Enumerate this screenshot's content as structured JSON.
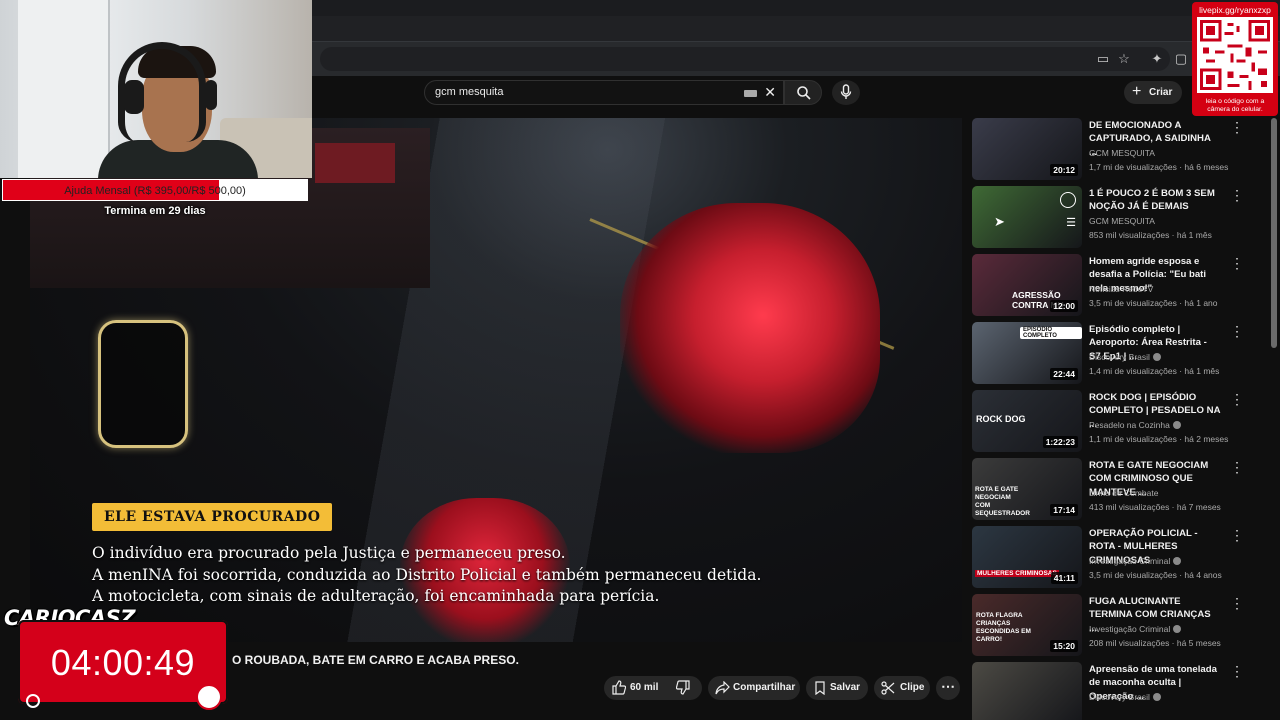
{
  "search": {
    "query": "gcm mesquita"
  },
  "header": {
    "create_label": "Criar"
  },
  "video": {
    "caption_tag": "ELE ESTAVA PROCURADO",
    "caption_lines": [
      "O indivíduo era procurado pela Justiça e permaneceu preso.",
      "A menINA foi socorrida, conduzida ao Distrito Policial e também permaneceu detida.",
      "A motocicleta, com sinais de adulteração, foi encaminhada para perícia."
    ],
    "title_visible": "O ROUBADA, BATE EM CARRO E ACABA PRESO.",
    "likes": "60 mil",
    "share_label": "Compartilhar",
    "save_label": "Salvar",
    "clip_label": "Clipe"
  },
  "recommendations": [
    {
      "title": "DE EMOCIONADO A CAPTURADO, A SAIDINHA ...",
      "channel": "GCM MESQUITA",
      "meta": "1,7 mi de visualizações · há 6 meses",
      "duration": "20:12",
      "verified": false,
      "thumb": "#3a3c4a"
    },
    {
      "title": "1 É POUCO 2 É BOM 3 SEM NOÇÃO JÁ É DEMAIS",
      "channel": "GCM MESQUITA",
      "meta": "853 mil visualizações · há 1 mês",
      "duration": "",
      "verified": false,
      "thumb": "#3f6a35"
    },
    {
      "title": "Homem agride esposa e desafia a Polícia: \"Eu bati nela mesmo!\"",
      "channel": "Notícias RedeTV",
      "meta": "3,5 mi de visualizações · há 1 ano",
      "duration": "12:00",
      "verified": false,
      "thumb": "#5a2a3a",
      "thumb_text": "AGRESSÃO CONTRA MU"
    },
    {
      "title": "Episódio completo | Aeroporto: Área Restrita - S7 Ep1 | ...",
      "channel": "Discovery Brasil",
      "meta": "1,4 mi de visualizações · há 1 mês",
      "duration": "22:44",
      "verified": true,
      "thumb": "#5b6470",
      "thumb_text": "EPISÓDIO COMPLETO"
    },
    {
      "title": "ROCK DOG | EPISÓDIO COMPLETO | PESADELO NA ...",
      "channel": "Pesadelo na Cozinha",
      "meta": "1,1 mi de visualizações · há 2 meses",
      "duration": "1:22:23",
      "verified": true,
      "thumb": "#2b2f36",
      "thumb_text": "ROCK DOG"
    },
    {
      "title": "ROTA E GATE NEGOCIAM COM CRIMINOSO QUE MANTEVE ...",
      "channel": "Linha de Combate",
      "meta": "413 mil visualizações · há 7 meses",
      "duration": "17:14",
      "verified": false,
      "thumb": "#3b3b3b",
      "thumb_text": "ROTA E GATE NEGOCIAM COM SEQUESTRADOR"
    },
    {
      "title": "OPERAÇÃO POLICIAL - ROTA - MULHERES CRIMINOSAS",
      "channel": "Investigação Criminal",
      "meta": "3,5 mi de visualizações · há 4 anos",
      "duration": "41:11",
      "verified": true,
      "thumb": "#2c3742",
      "thumb_text": "MULHERES CRIMINOSAS"
    },
    {
      "title": "FUGA ALUCINANTE TERMINA COM CRIANÇAS ...",
      "channel": "Investigação Criminal",
      "meta": "208 mil visualizações · há 5 meses",
      "duration": "15:20",
      "verified": true,
      "thumb": "#4a2a2a",
      "thumb_text": "ROTA FLAGRA CRIANÇAS ESCONDIDAS EM CARRO!"
    },
    {
      "title": "Apreensão de uma tonelada de maconha oculta | Operação ...",
      "channel": "Discovery Brasil",
      "meta": "",
      "duration": "",
      "verified": true,
      "thumb": "#4c4a44"
    }
  ],
  "overlay": {
    "goal_text": "Ajuda Mensal (R$ 395,00/R$ 500,00)",
    "goal_progress": 0.71,
    "goal_sub": "Termina em 29 dias",
    "qr_url": "livepix.gg/ryanxzxp",
    "qr_note": "leia o código com a câmera do celular.",
    "brand": "CARIOCASZ",
    "timer": "04:00:49"
  },
  "colors": {
    "accent": "#d4001a",
    "caption_tag": "#f3bd37",
    "background": "#0f0f0f"
  }
}
